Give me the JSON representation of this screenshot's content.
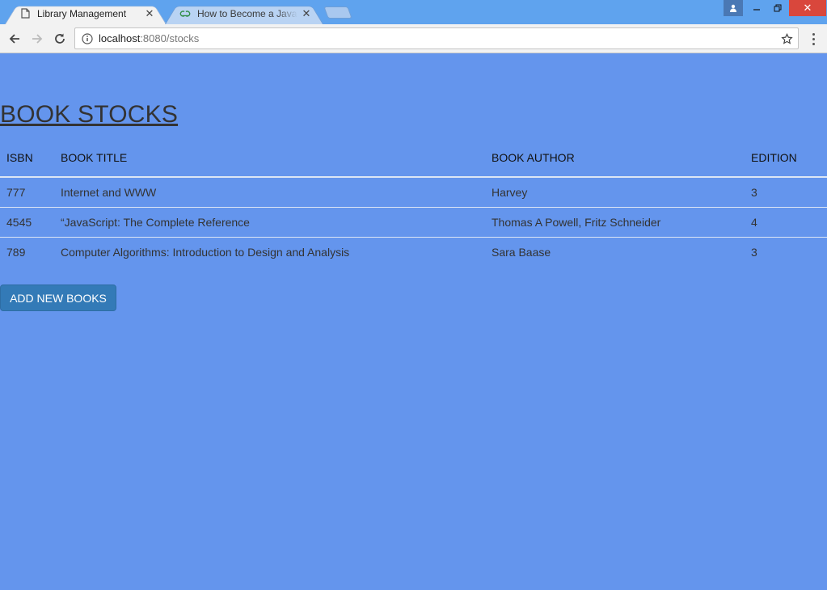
{
  "browser": {
    "tabs": [
      {
        "label": "Library Management",
        "icon": "page-icon",
        "active": true
      },
      {
        "label": "How to Become a JavaScript Developer",
        "icon": "gfg-favicon",
        "active": false
      }
    ],
    "url_host": "localhost",
    "url_path": ":8080/stocks",
    "colors": {
      "titlebar": "#5fa3ee",
      "close_button": "#d9473c"
    }
  },
  "page": {
    "title": "BOOK STOCKS",
    "background": "#6495ed",
    "table": {
      "headers": [
        "ISBN",
        "BOOK TITLE",
        "BOOK AUTHOR",
        "EDITION"
      ],
      "rows": [
        {
          "isbn": "777",
          "title": "Internet and WWW",
          "author": "Harvey",
          "edition": "3"
        },
        {
          "isbn": "4545",
          "title": "“JavaScript: The Complete Reference",
          "author": "Thomas A Powell, Fritz Schneider",
          "edition": "4"
        },
        {
          "isbn": "789",
          "title": "Computer Algorithms: Introduction to Design and Analysis",
          "author": "Sara Baase",
          "edition": "3"
        }
      ]
    },
    "add_button_label": "ADD NEW BOOKS",
    "button_color": "#337ab7"
  }
}
